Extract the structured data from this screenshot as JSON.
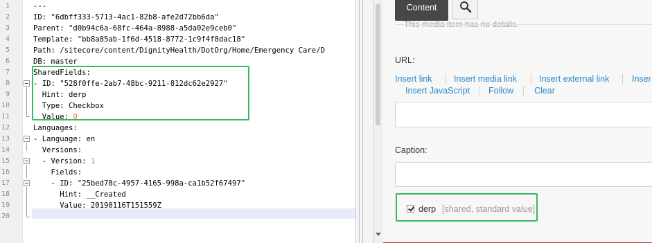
{
  "editor": {
    "lines": [
      {
        "n": "1",
        "segments": [
          {
            "t": "---"
          }
        ]
      },
      {
        "n": "2",
        "segments": [
          {
            "t": "ID: \"6dbff333-5713-4ac1-82b8-afe2d72bb6da\""
          }
        ]
      },
      {
        "n": "3",
        "segments": [
          {
            "t": "Parent: \"d0b94c6a-68fc-464a-8988-a5da02e9ceb0\""
          }
        ]
      },
      {
        "n": "4",
        "segments": [
          {
            "t": "Template: \"bb8a85ab-1f6d-4518-8772-1c9f4f8dac18\""
          }
        ]
      },
      {
        "n": "5",
        "segments": [
          {
            "t": "Path: /sitecore/content/DignityHealth/DotOrg/Home/Emergency Care/D"
          }
        ]
      },
      {
        "n": "6",
        "segments": [
          {
            "t": "DB: master"
          }
        ]
      },
      {
        "n": "7",
        "segments": [
          {
            "t": "SharedFields:"
          }
        ]
      },
      {
        "n": "8",
        "segments": [
          {
            "t": "- ID: \"528f0ffe-2ab7-48bc-9211-812dc62e2927\""
          }
        ]
      },
      {
        "n": "9",
        "segments": [
          {
            "t": "  Hint: derp"
          }
        ]
      },
      {
        "n": "10",
        "segments": [
          {
            "t": "  Type: Checkbox"
          }
        ]
      },
      {
        "n": "11",
        "segments": [
          {
            "t": "  Value: "
          },
          {
            "t": "0",
            "num": true
          }
        ]
      },
      {
        "n": "12",
        "segments": [
          {
            "t": "Languages:"
          }
        ]
      },
      {
        "n": "13",
        "segments": [
          {
            "t": "- Language: en"
          }
        ]
      },
      {
        "n": "14",
        "segments": [
          {
            "t": "  Versions:"
          }
        ]
      },
      {
        "n": "15",
        "segments": [
          {
            "t": "  - Version: "
          },
          {
            "t": "1",
            "num": true
          }
        ]
      },
      {
        "n": "16",
        "segments": [
          {
            "t": "    Fields:"
          }
        ]
      },
      {
        "n": "17",
        "segments": [
          {
            "t": "    - ID: \"25bed78c-4957-4165-998a-ca1b52f67497\""
          }
        ]
      },
      {
        "n": "18",
        "segments": [
          {
            "t": "      Hint: __Created"
          }
        ]
      },
      {
        "n": "19",
        "segments": [
          {
            "t": "      Value: 20190116T151559Z"
          }
        ]
      },
      {
        "n": "20",
        "segments": [
          {
            "t": ""
          }
        ]
      }
    ]
  },
  "panel": {
    "tabs": [
      {
        "label": "Content",
        "active": true
      },
      {
        "icon": "search-icon"
      }
    ],
    "no_details": "This media item has no details.",
    "url_label": "URL:",
    "links_row1": [
      "Insert link",
      "Insert media link",
      "Insert external link",
      "Inser"
    ],
    "links_row2": [
      "Insert JavaScript",
      "Follow",
      "Clear"
    ],
    "caption_label": "Caption:",
    "checkbox": {
      "checked": true,
      "label": "derp",
      "note": "[shared, standard value]"
    }
  },
  "colors": {
    "highlight_box": "#3cb764",
    "link": "#2a89c7",
    "active_tab": "#474747",
    "number": "#e07b3a",
    "current_line": "#e8ebfb"
  }
}
